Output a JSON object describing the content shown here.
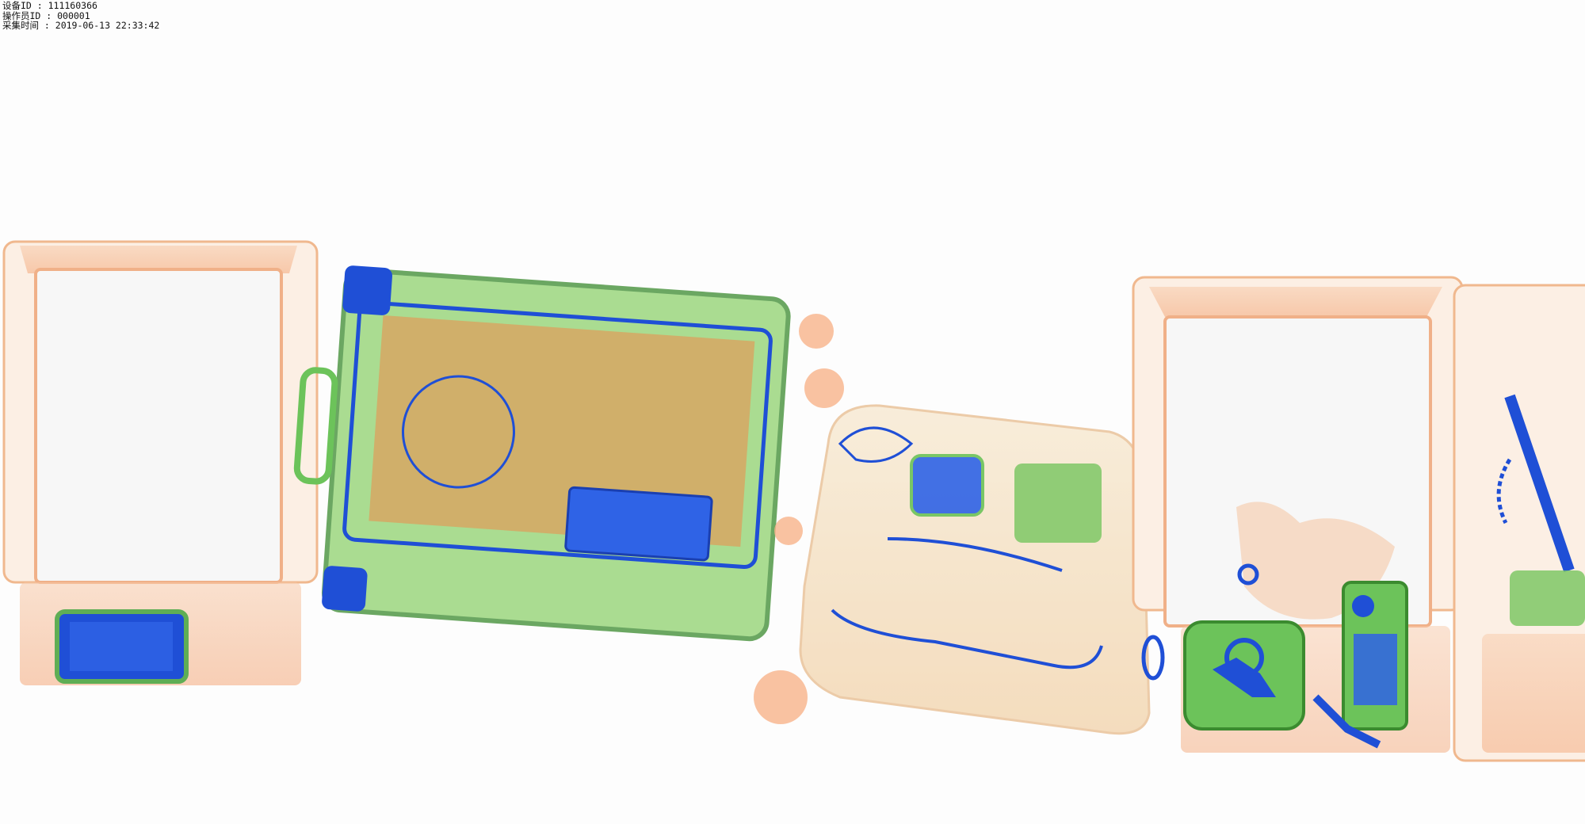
{
  "overlay": {
    "device_id_line": "设备ID : 111160366",
    "operator_id_line": "操作员ID : 000001",
    "capture_time_line": "采集时间 : 2019-06-13 22:33:42"
  },
  "colors": {
    "background": "#fdfdfd",
    "organic": "#f08a4b",
    "mixed": "#6cc35a",
    "metal": "#1f4fd6",
    "tray_fill": "#fbe9dc"
  },
  "scene_objects": [
    "tray-1-with-tablet",
    "suitcase",
    "bag-with-cables",
    "tray-2-with-keys-and-phone",
    "tray-3-partial"
  ]
}
